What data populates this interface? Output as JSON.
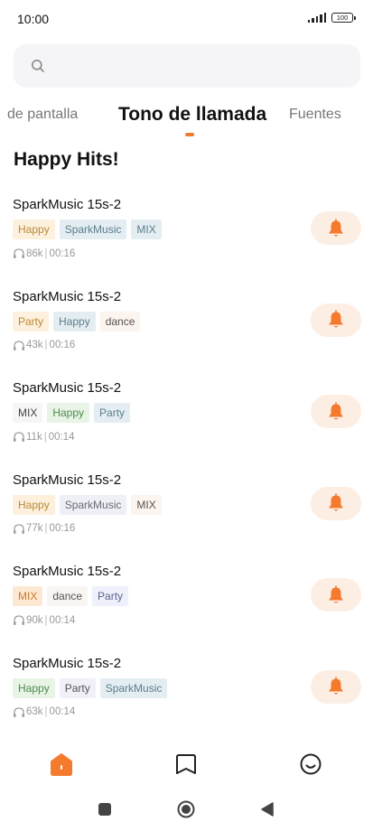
{
  "status_bar": {
    "time": "10:00",
    "battery": "100"
  },
  "search": {
    "placeholder": ""
  },
  "tabs": [
    "de pantalla",
    "Tono de llamada",
    "Fuentes"
  ],
  "section_title": "Happy Hits!",
  "colors": {
    "accent": "#f47a2e",
    "ring_button_bg": "#fdeee4"
  },
  "songs": [
    {
      "title": "SparkMusic 15s-2",
      "tags": [
        "Happy",
        "SparkMusic",
        "MIX"
      ],
      "plays": "86k",
      "duration": "00:16"
    },
    {
      "title": "SparkMusic 15s-2",
      "tags": [
        "Party",
        "Happy",
        "dance"
      ],
      "plays": "43k",
      "duration": "00:16"
    },
    {
      "title": "SparkMusic 15s-2",
      "tags": [
        "MIX",
        "Happy",
        "Party"
      ],
      "plays": "11k",
      "duration": "00:14"
    },
    {
      "title": "SparkMusic 15s-2",
      "tags": [
        "Happy",
        "SparkMusic",
        "MIX"
      ],
      "plays": "77k",
      "duration": "00:16"
    },
    {
      "title": "SparkMusic 15s-2",
      "tags": [
        "MIX",
        "dance",
        "Party"
      ],
      "plays": "90k",
      "duration": "00:14"
    },
    {
      "title": "SparkMusic 15s-2",
      "tags": [
        "Happy",
        "Party",
        "SparkMusic"
      ],
      "plays": "63k",
      "duration": "00:14"
    }
  ],
  "tag_styles": [
    [
      {
        "bg": "#fdf0dc",
        "fg": "#b98a3a"
      },
      {
        "bg": "#e4eef2",
        "fg": "#5a7d8c"
      },
      {
        "bg": "#e4eef2",
        "fg": "#5a7d8c"
      }
    ],
    [
      {
        "bg": "#fdf0dc",
        "fg": "#b98a3a"
      },
      {
        "bg": "#e4eef2",
        "fg": "#5a7d8c"
      },
      {
        "bg": "#fbf4ef",
        "fg": "#555555"
      }
    ],
    [
      {
        "bg": "#f6f6f6",
        "fg": "#444444"
      },
      {
        "bg": "#e8f4e6",
        "fg": "#4e8a4b"
      },
      {
        "bg": "#e4eef2",
        "fg": "#5a7d8c"
      }
    ],
    [
      {
        "bg": "#fdf0dc",
        "fg": "#b98a3a"
      },
      {
        "bg": "#efeff6",
        "fg": "#6b6b78"
      },
      {
        "bg": "#fbf4ef",
        "fg": "#555555"
      }
    ],
    [
      {
        "bg": "#fde9d3",
        "fg": "#c97a2e"
      },
      {
        "bg": "#f8f5f3",
        "fg": "#555555"
      },
      {
        "bg": "#eef0fb",
        "fg": "#5c6390"
      }
    ],
    [
      {
        "bg": "#e8f4e6",
        "fg": "#4e8a4b"
      },
      {
        "bg": "#f1f0f8",
        "fg": "#555555"
      },
      {
        "bg": "#e4eef2",
        "fg": "#5a7d8c"
      }
    ]
  ],
  "bottom_nav": [
    {
      "icon": "home-icon",
      "active": true
    },
    {
      "icon": "bookmark-icon",
      "active": false
    },
    {
      "icon": "smile-icon",
      "active": false
    }
  ],
  "system_nav": [
    {
      "icon": "recents-icon"
    },
    {
      "icon": "home-circle-icon"
    },
    {
      "icon": "back-icon"
    }
  ]
}
